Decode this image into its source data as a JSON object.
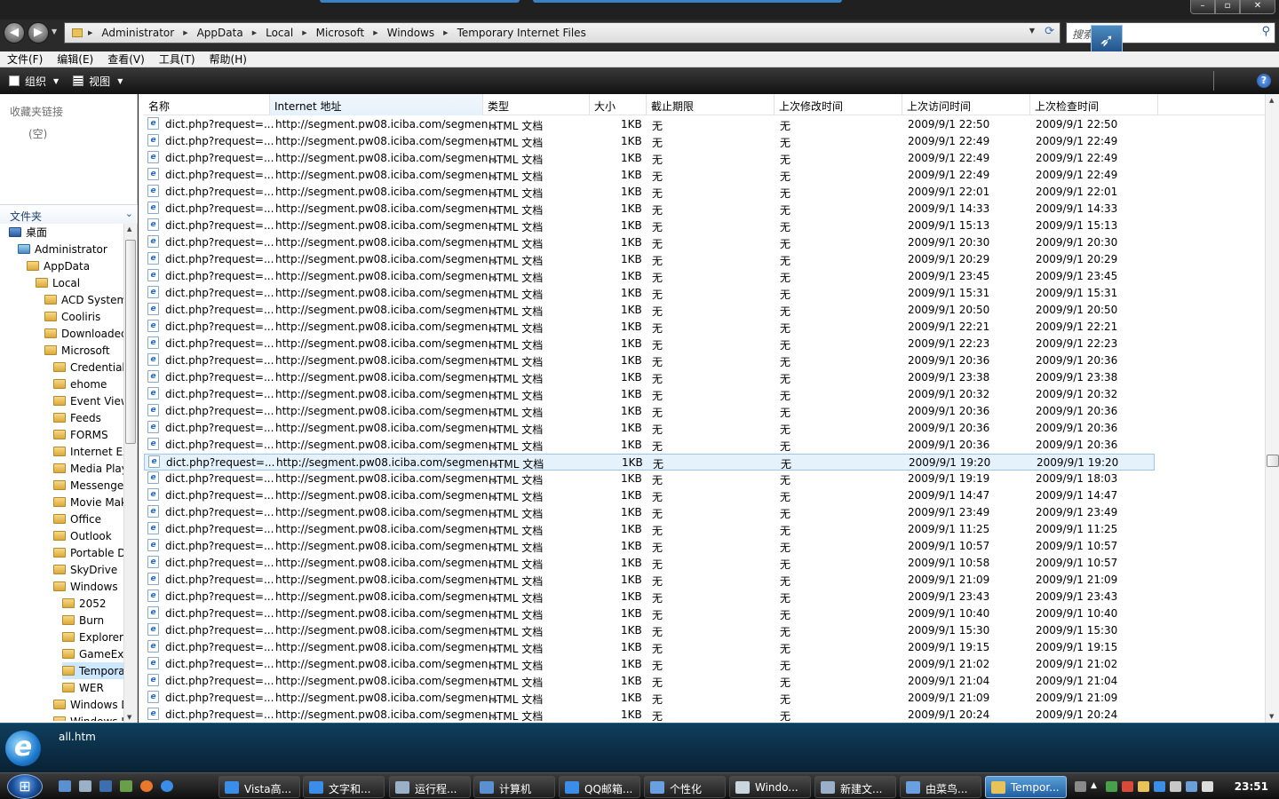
{
  "window": {
    "minimize": "–",
    "maximize": "▫",
    "close": "✕"
  },
  "address": {
    "crumbs": [
      "Administrator",
      "AppData",
      "Local",
      "Microsoft",
      "Windows",
      "Temporary Internet Files"
    ],
    "back_icon": "back-arrow-icon",
    "forward_icon": "forward-arrow-icon"
  },
  "search": {
    "placeholder": "搜索"
  },
  "menu": [
    "文件(F)",
    "编辑(E)",
    "查看(V)",
    "工具(T)",
    "帮助(H)"
  ],
  "toolbar": {
    "organize": "组织",
    "views": "视图",
    "help": "?"
  },
  "nav": {
    "favorites_header": "收藏夹链接",
    "favorites_empty": "(空)",
    "folders_header": "文件夹",
    "tree": [
      {
        "label": "桌面",
        "level": 0,
        "kind": "desktop"
      },
      {
        "label": "Administrator",
        "level": 1,
        "kind": "user"
      },
      {
        "label": "AppData",
        "level": 2,
        "kind": "folder"
      },
      {
        "label": "Local",
        "level": 3,
        "kind": "folder"
      },
      {
        "label": "ACD Systems",
        "level": 4,
        "kind": "folder"
      },
      {
        "label": "Cooliris",
        "level": 4,
        "kind": "folder"
      },
      {
        "label": "Downloaded",
        "level": 4,
        "kind": "folder"
      },
      {
        "label": "Microsoft",
        "level": 4,
        "kind": "folder"
      },
      {
        "label": "Credentials",
        "level": 5,
        "kind": "folder"
      },
      {
        "label": "ehome",
        "level": 5,
        "kind": "folder"
      },
      {
        "label": "Event View",
        "level": 5,
        "kind": "folder"
      },
      {
        "label": "Feeds",
        "level": 5,
        "kind": "folder"
      },
      {
        "label": "FORMS",
        "level": 5,
        "kind": "folder"
      },
      {
        "label": "Internet Exp",
        "level": 5,
        "kind": "folder"
      },
      {
        "label": "Media Play",
        "level": 5,
        "kind": "folder"
      },
      {
        "label": "Messenger",
        "level": 5,
        "kind": "folder"
      },
      {
        "label": "Movie Mak",
        "level": 5,
        "kind": "folder"
      },
      {
        "label": "Office",
        "level": 5,
        "kind": "folder"
      },
      {
        "label": "Outlook",
        "level": 5,
        "kind": "folder"
      },
      {
        "label": "Portable D",
        "level": 5,
        "kind": "folder"
      },
      {
        "label": "SkyDrive",
        "level": 5,
        "kind": "folder"
      },
      {
        "label": "Windows",
        "level": 5,
        "kind": "folder"
      },
      {
        "label": "2052",
        "level": 6,
        "kind": "folder"
      },
      {
        "label": "Burn",
        "level": 6,
        "kind": "folder"
      },
      {
        "label": "Explorer",
        "level": 6,
        "kind": "folder"
      },
      {
        "label": "GameExp",
        "level": 6,
        "kind": "folder"
      },
      {
        "label": "Tempora",
        "level": 6,
        "kind": "folder",
        "selected": true
      },
      {
        "label": "WER",
        "level": 6,
        "kind": "folder"
      },
      {
        "label": "Windows D",
        "level": 5,
        "kind": "folder"
      },
      {
        "label": "Windows L",
        "level": 5,
        "kind": "folder"
      }
    ]
  },
  "columns": [
    "名称",
    "Internet 地址",
    "类型",
    "大小",
    "截止期限",
    "上次修改时间",
    "上次访问时间",
    "上次检查时间"
  ],
  "files": {
    "name": "dict.php?request=...",
    "url": "http://segment.pw08.iciba.com/segmen...",
    "type": "HTML 文档",
    "size": "1KB",
    "expires": "无",
    "modified": "无",
    "selected_index": 20,
    "times": [
      [
        "2009/9/1 22:50",
        "2009/9/1 22:50"
      ],
      [
        "2009/9/1 22:49",
        "2009/9/1 22:49"
      ],
      [
        "2009/9/1 22:49",
        "2009/9/1 22:49"
      ],
      [
        "2009/9/1 22:49",
        "2009/9/1 22:49"
      ],
      [
        "2009/9/1 22:01",
        "2009/9/1 22:01"
      ],
      [
        "2009/9/1 14:33",
        "2009/9/1 14:33"
      ],
      [
        "2009/9/1 15:13",
        "2009/9/1 15:13"
      ],
      [
        "2009/9/1 20:30",
        "2009/9/1 20:30"
      ],
      [
        "2009/9/1 20:29",
        "2009/9/1 20:29"
      ],
      [
        "2009/9/1 23:45",
        "2009/9/1 23:45"
      ],
      [
        "2009/9/1 15:31",
        "2009/9/1 15:31"
      ],
      [
        "2009/9/1 20:50",
        "2009/9/1 20:50"
      ],
      [
        "2009/9/1 22:21",
        "2009/9/1 22:21"
      ],
      [
        "2009/9/1 22:23",
        "2009/9/1 22:23"
      ],
      [
        "2009/9/1 20:36",
        "2009/9/1 20:36"
      ],
      [
        "2009/9/1 23:38",
        "2009/9/1 23:38"
      ],
      [
        "2009/9/1 20:32",
        "2009/9/1 20:32"
      ],
      [
        "2009/9/1 20:36",
        "2009/9/1 20:36"
      ],
      [
        "2009/9/1 20:36",
        "2009/9/1 20:36"
      ],
      [
        "2009/9/1 20:36",
        "2009/9/1 20:36"
      ],
      [
        "2009/9/1 19:20",
        "2009/9/1 19:20"
      ],
      [
        "2009/9/1 19:19",
        "2009/9/1 18:03"
      ],
      [
        "2009/9/1 14:47",
        "2009/9/1 14:47"
      ],
      [
        "2009/9/1 23:49",
        "2009/9/1 23:49"
      ],
      [
        "2009/9/1 11:25",
        "2009/9/1 11:25"
      ],
      [
        "2009/9/1 10:57",
        "2009/9/1 10:57"
      ],
      [
        "2009/9/1 10:58",
        "2009/9/1 10:57"
      ],
      [
        "2009/9/1 21:09",
        "2009/9/1 21:09"
      ],
      [
        "2009/9/1 23:43",
        "2009/9/1 23:43"
      ],
      [
        "2009/9/1 10:40",
        "2009/9/1 10:40"
      ],
      [
        "2009/9/1 15:30",
        "2009/9/1 15:30"
      ],
      [
        "2009/9/1 19:15",
        "2009/9/1 19:15"
      ],
      [
        "2009/9/1 21:02",
        "2009/9/1 21:02"
      ],
      [
        "2009/9/1 21:04",
        "2009/9/1 21:04"
      ],
      [
        "2009/9/1 21:09",
        "2009/9/1 21:09"
      ],
      [
        "2009/9/1 20:24",
        "2009/9/1 20:24"
      ]
    ]
  },
  "details": {
    "filename": "all.htm"
  },
  "taskbar": {
    "start_icon": "windows-orb-icon",
    "buttons": [
      {
        "label": "Vista高...",
        "icon_color": "#3b8ee8"
      },
      {
        "label": "文字和...",
        "icon_color": "#3b8ee8"
      },
      {
        "label": "运行程...",
        "icon_color": "#9ab0c8"
      },
      {
        "label": "计算机",
        "icon_color": "#5a8fd0"
      },
      {
        "label": "QQ邮箱...",
        "icon_color": "#3b8ee8"
      },
      {
        "label": "个性化",
        "icon_color": "#6aa0e0"
      },
      {
        "label": "Windo...",
        "icon_color": "#c9d6e0"
      },
      {
        "label": "新建文...",
        "icon_color": "#9ab0c8"
      },
      {
        "label": "由菜鸟...",
        "icon_color": "#6aa0e0"
      },
      {
        "label": "Tempor...",
        "icon_color": "#e8c35a",
        "active": true
      }
    ],
    "clock": "23:51"
  }
}
